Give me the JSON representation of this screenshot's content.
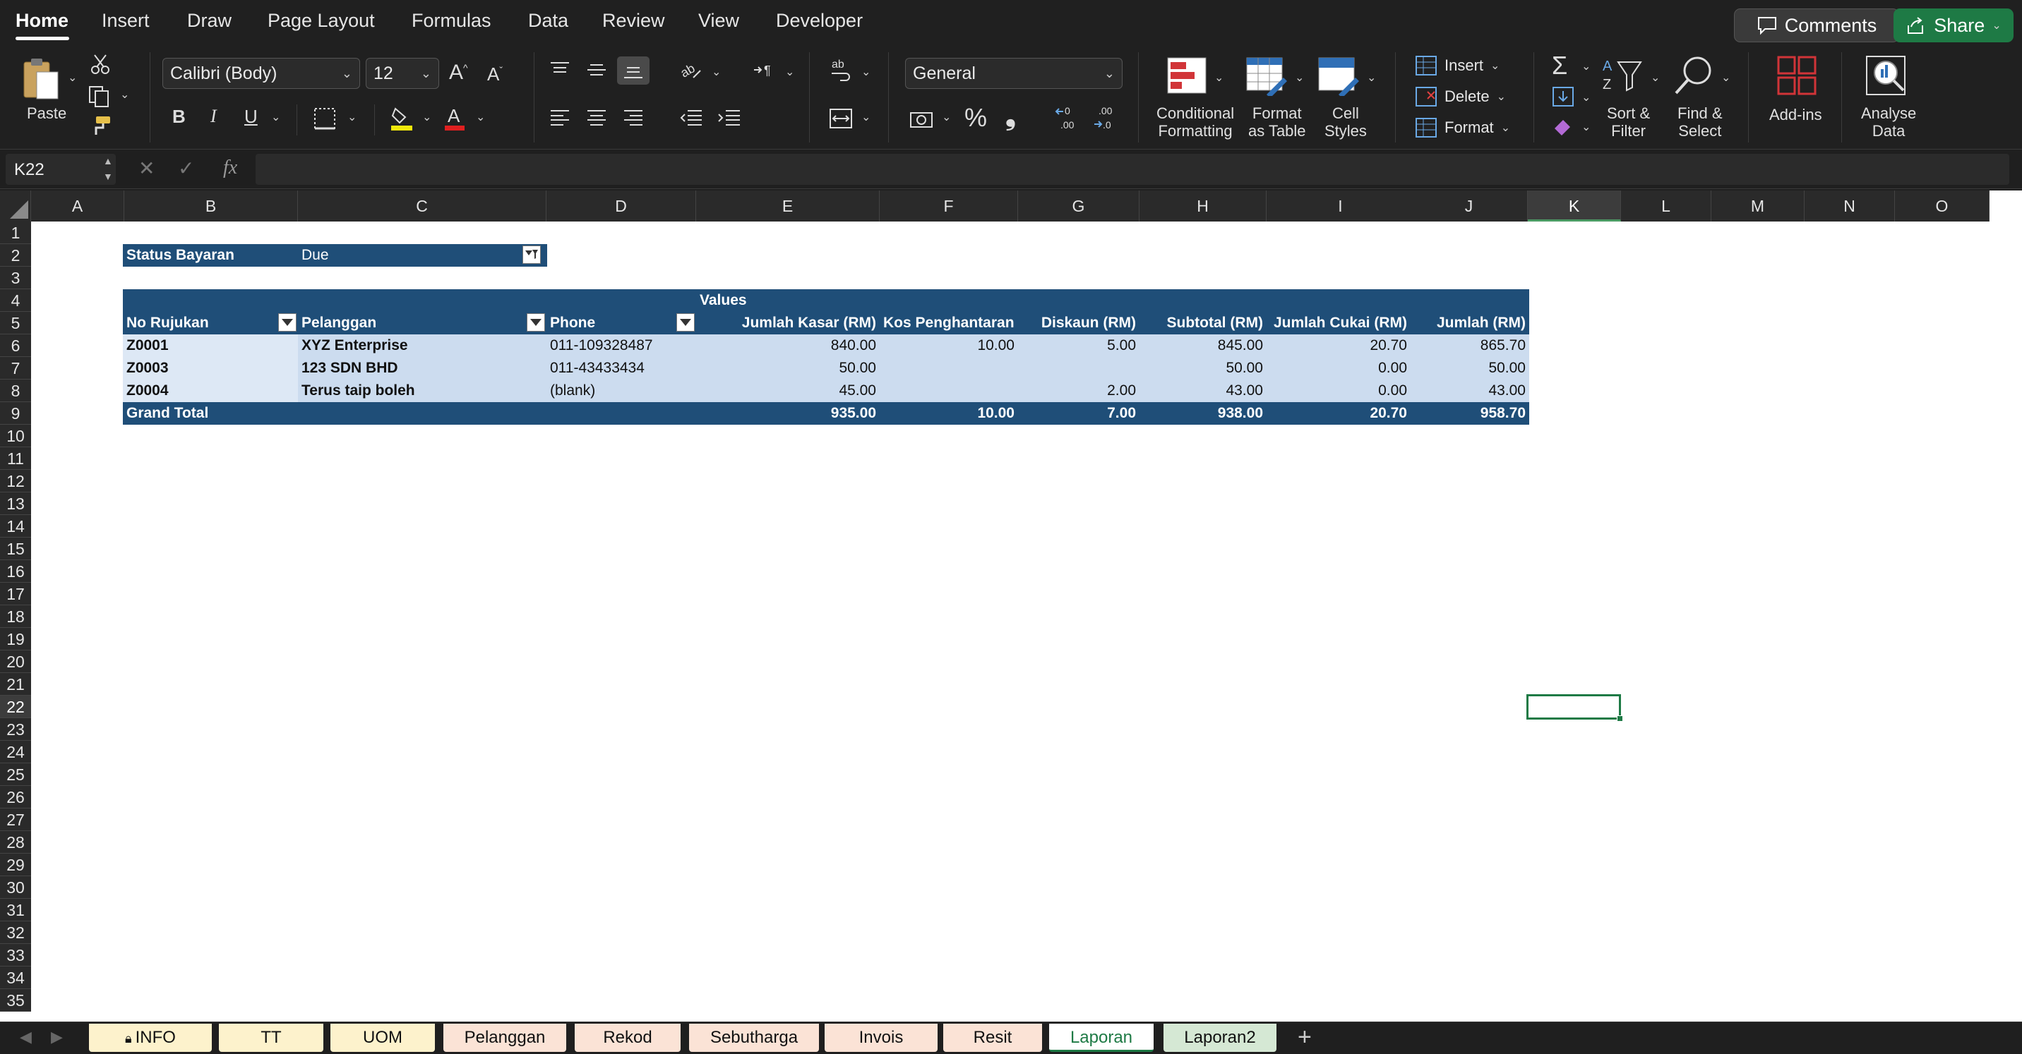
{
  "menu": {
    "items": [
      "Home",
      "Insert",
      "Draw",
      "Page Layout",
      "Formulas",
      "Data",
      "Review",
      "View",
      "Developer"
    ],
    "comments_label": "Comments",
    "share_label": "Share"
  },
  "ribbon": {
    "paste_label": "Paste",
    "font_name": "Calibri (Body)",
    "font_size": "12",
    "number_format": "General",
    "conditional_formatting": [
      "Conditional",
      "Formatting"
    ],
    "format_as_table": [
      "Format",
      "as Table"
    ],
    "cell_styles": [
      "Cell",
      "Styles"
    ],
    "insert_label": "Insert",
    "delete_label": "Delete",
    "format_label": "Format",
    "sort_filter": [
      "Sort &",
      "Filter"
    ],
    "find_select": [
      "Find &",
      "Select"
    ],
    "addins_label": "Add-ins",
    "analyse_data": [
      "Analyse",
      "Data"
    ]
  },
  "formula_bar": {
    "name_box": "K22",
    "fx": "fx",
    "value": ""
  },
  "grid": {
    "columns": [
      "A",
      "B",
      "C",
      "D",
      "E",
      "F",
      "G",
      "H",
      "I",
      "J",
      "K",
      "L",
      "M",
      "N",
      "O"
    ],
    "selected_column": "K",
    "rows": [
      "1",
      "2",
      "3",
      "4",
      "5",
      "6",
      "7",
      "8",
      "9",
      "10",
      "11",
      "12",
      "13",
      "14",
      "15",
      "16",
      "17",
      "18",
      "19",
      "20",
      "21",
      "22",
      "23",
      "24",
      "25",
      "26",
      "27",
      "28",
      "29",
      "30",
      "31",
      "32",
      "33",
      "34",
      "35"
    ],
    "selected_row": "22"
  },
  "pivot": {
    "filter_label": "Status Bayaran",
    "filter_value": "Due",
    "values_caption": "Values",
    "headers": [
      "No Rujukan",
      "Pelanggan",
      "Phone",
      "Jumlah Kasar (RM)",
      "Kos Penghantaran (RM)",
      "Diskaun (RM)",
      "Subtotal (RM)",
      "Jumlah Cukai (RM)",
      "Jumlah (RM)"
    ],
    "rows": [
      [
        "Z0001",
        "XYZ Enterprise",
        "011-109328487",
        "840.00",
        "10.00",
        "5.00",
        "845.00",
        "20.70",
        "865.70"
      ],
      [
        "Z0003",
        "123 SDN BHD",
        "011-43433434",
        "50.00",
        "",
        "",
        "50.00",
        "0.00",
        "50.00"
      ],
      [
        "Z0004",
        "Terus taip boleh",
        "(blank)",
        "45.00",
        "",
        "2.00",
        "43.00",
        "0.00",
        "43.00"
      ]
    ],
    "grand_total": [
      "Grand Total",
      "",
      "",
      "935.00",
      "10.00",
      "7.00",
      "938.00",
      "20.70",
      "958.70"
    ]
  },
  "sheet_tabs": [
    {
      "label": "INFO",
      "color": "#fdf2cc",
      "locked": true
    },
    {
      "label": "TT",
      "color": "#fdf2cc"
    },
    {
      "label": "UOM",
      "color": "#fdf2cc"
    },
    {
      "label": "Pelanggan",
      "color": "#fbe3d6"
    },
    {
      "label": "Rekod",
      "color": "#fbe3d6"
    },
    {
      "label": "Sebutharga",
      "color": "#fbe3d6"
    },
    {
      "label": "Invois",
      "color": "#fbe3d6"
    },
    {
      "label": "Resit",
      "color": "#fbe3d6"
    },
    {
      "label": "Laporan",
      "color": "#ffffff",
      "active": true
    },
    {
      "label": "Laporan2",
      "color": "#d5e8d4"
    }
  ],
  "colors": {
    "pivot_header": "#1f4e78",
    "pivot_row": "#ccdcef",
    "accent_green": "#1e7a45"
  }
}
